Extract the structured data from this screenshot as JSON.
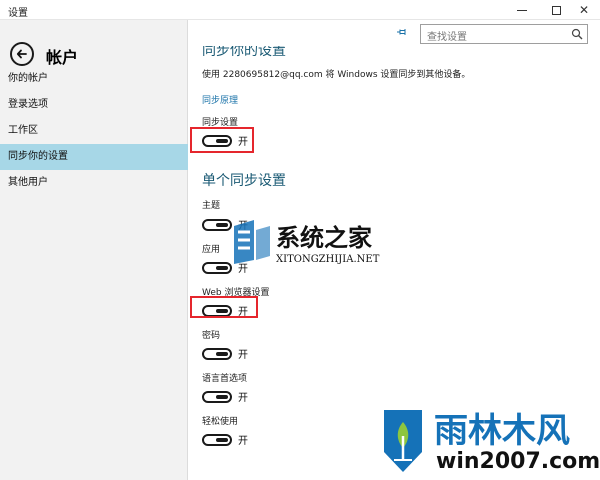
{
  "window": {
    "title": "设置",
    "minimize_glyph": "—",
    "maximize_glyph": "□",
    "close_glyph": "✕"
  },
  "header": {
    "title": "帐户"
  },
  "sidebar": {
    "items": [
      {
        "label": "你的帐户",
        "active": false
      },
      {
        "label": "登录选项",
        "active": false
      },
      {
        "label": "工作区",
        "active": false
      },
      {
        "label": "同步你的设置",
        "active": true
      },
      {
        "label": "其他用户",
        "active": false
      }
    ]
  },
  "search": {
    "placeholder": "查找设置"
  },
  "main": {
    "section_title_cut": "同步你的设置",
    "description": "使用 2280695812@qq.com 将 Windows 设置同步到其他设备。",
    "link": "同步原理",
    "sync_settings": {
      "label": "同步设置",
      "state": "开",
      "on": true
    },
    "section2_title": "单个同步设置",
    "settings": [
      {
        "label": "主题",
        "state": "开",
        "on": true
      },
      {
        "label": "应用",
        "state": "开",
        "on": true
      },
      {
        "label": "Web 浏览器设置",
        "state": "开",
        "on": true
      },
      {
        "label": "密码",
        "state": "开",
        "on": true
      },
      {
        "label": "语言首选项",
        "state": "开",
        "on": true
      },
      {
        "label": "轻松使用",
        "state": "开",
        "on": true
      }
    ]
  },
  "watermarks": {
    "xitong_cn": "系统之家",
    "xitong_en": "XITONGZHIJIA.NET",
    "yulin_cn": "雨林木风",
    "yulin_en": "win2007.com"
  },
  "colors": {
    "accent_section": "#1a5a74",
    "link": "#1a72a8",
    "nav_active": "#a7d7e7",
    "highlight_box": "#e5262d",
    "watermark_blue": "#1572b8"
  }
}
